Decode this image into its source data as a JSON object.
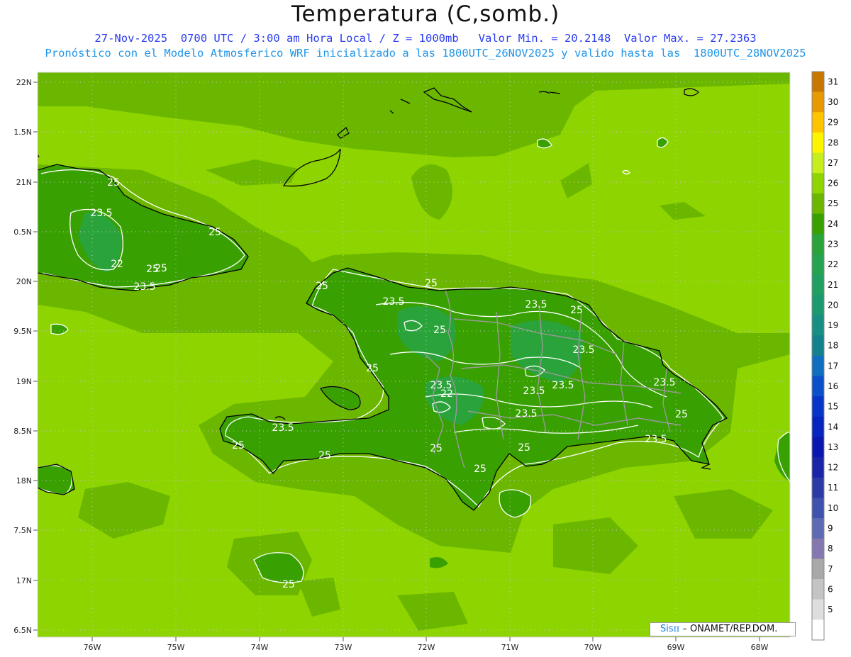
{
  "header": {
    "title": "Temperatura (C,somb.)",
    "line1": "27-Nov-2025  0700 UTC / 3:00 am Hora Local / Z = 1000mb   Valor Min. = 20.2148  Valor Max. = 27.2363",
    "line2": "Pronóstico con el Modelo Atmosferico WRF inicializado a las 1800UTC_26NOV2025 y valido hasta las  1800UTC_28NOV2025"
  },
  "map": {
    "lat_labels": [
      "22N",
      "1.5N",
      "21N",
      "0.5N",
      "20N",
      "9.5N",
      "19N",
      "8.5N",
      "18N",
      "7.5N",
      "17N",
      "6.5N"
    ],
    "lon_labels": [
      "76W",
      "75W",
      "74W",
      "73W",
      "72W",
      "71W",
      "70W",
      "69W",
      "68W"
    ],
    "contour_labels": [
      "25",
      "23.5",
      "25",
      "22",
      "25",
      "23.5",
      "25",
      "25",
      "23.5",
      "25",
      "23.5",
      "25",
      "23.5",
      "25",
      "23.5",
      "22",
      "23.5",
      "23.5",
      "23.5",
      "23.5",
      "25",
      "23.5",
      "25",
      "25",
      "25",
      "25",
      "23.5",
      "25",
      "25",
      "25"
    ],
    "colors": {
      "ocean": "#8ed400",
      "land_dark": "#38a000",
      "band_mid": "#6bb700",
      "coast": "#000000",
      "border": "#9a9a9a",
      "contour": "#ffffff"
    }
  },
  "legend": {
    "levels": [
      "31",
      "30",
      "29",
      "28",
      "27",
      "26",
      "25",
      "24",
      "23",
      "22",
      "21",
      "20",
      "19",
      "18",
      "17",
      "16",
      "15",
      "14",
      "13",
      "12",
      "11",
      "10",
      "9",
      "8",
      "7",
      "6",
      "5"
    ],
    "colors": [
      "#c87800",
      "#e69a00",
      "#ffc400",
      "#fff400",
      "#c6ee1c",
      "#8ed400",
      "#6bb700",
      "#38a000",
      "#2aa33a",
      "#25a34f",
      "#20a060",
      "#1b9a72",
      "#178f82",
      "#14828e",
      "#0f6ec0",
      "#0a50c8",
      "#0635c8",
      "#0524c0",
      "#0a16b0",
      "#1a24a8",
      "#2c3aa8",
      "#3f52ad",
      "#5e6ab4",
      "#8577b0",
      "#a8a8a8",
      "#c4c4c4",
      "#dedede",
      "#ffffff"
    ]
  },
  "credit": {
    "sis": "Sis",
    "pi": "π",
    "text": " – ONAMET/REP.DOM."
  }
}
